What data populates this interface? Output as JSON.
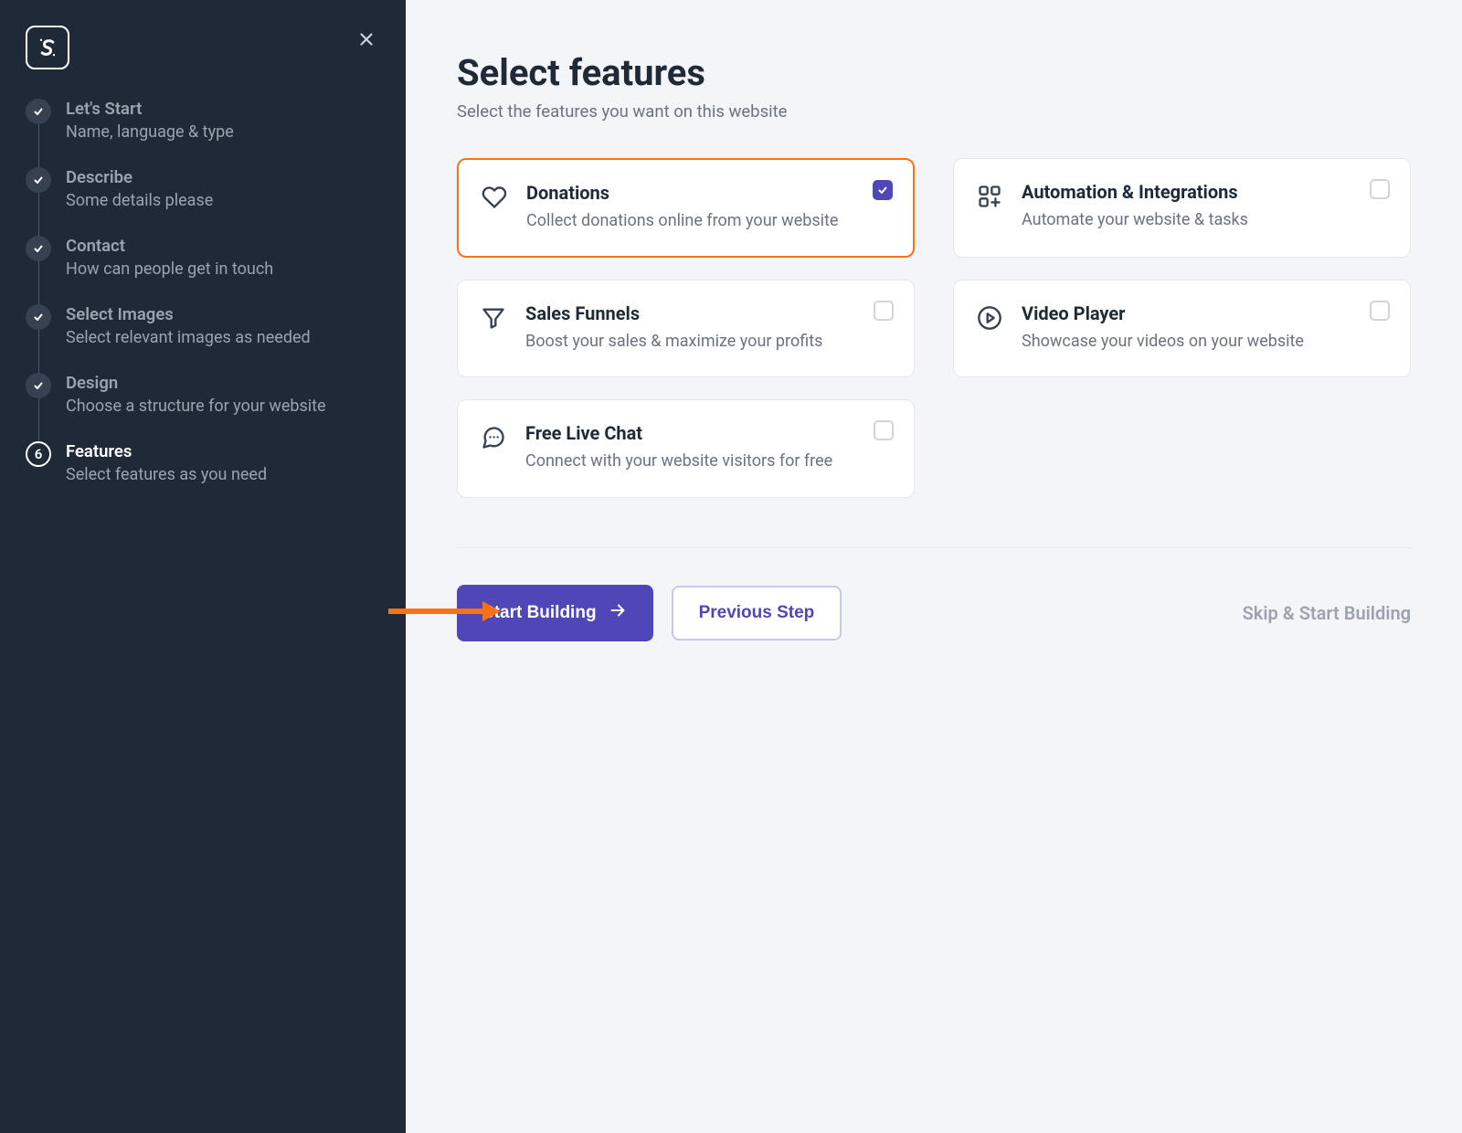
{
  "sidebar": {
    "steps": [
      {
        "title": "Let's Start",
        "sub": "Name, language & type",
        "done": true
      },
      {
        "title": "Describe",
        "sub": "Some details please",
        "done": true
      },
      {
        "title": "Contact",
        "sub": "How can people get in touch",
        "done": true
      },
      {
        "title": "Select Images",
        "sub": "Select relevant images as needed",
        "done": true
      },
      {
        "title": "Design",
        "sub": "Choose a structure for your website",
        "done": true
      },
      {
        "title": "Features",
        "sub": "Select features as you need",
        "done": false,
        "number": "6"
      }
    ]
  },
  "main": {
    "title": "Select features",
    "subtitle": "Select the features you want on this website",
    "features": [
      {
        "title": "Donations",
        "desc": "Collect donations online from your website",
        "selected": true
      },
      {
        "title": "Automation & Integrations",
        "desc": "Automate your website & tasks",
        "selected": false
      },
      {
        "title": "Sales Funnels",
        "desc": "Boost your sales & maximize your profits",
        "selected": false
      },
      {
        "title": "Video Player",
        "desc": "Showcase your videos on your website",
        "selected": false
      },
      {
        "title": "Free Live Chat",
        "desc": "Connect with your website visitors for free",
        "selected": false
      }
    ],
    "actions": {
      "primary": "Start Building",
      "secondary": "Previous Step",
      "skip": "Skip & Start Building"
    }
  }
}
